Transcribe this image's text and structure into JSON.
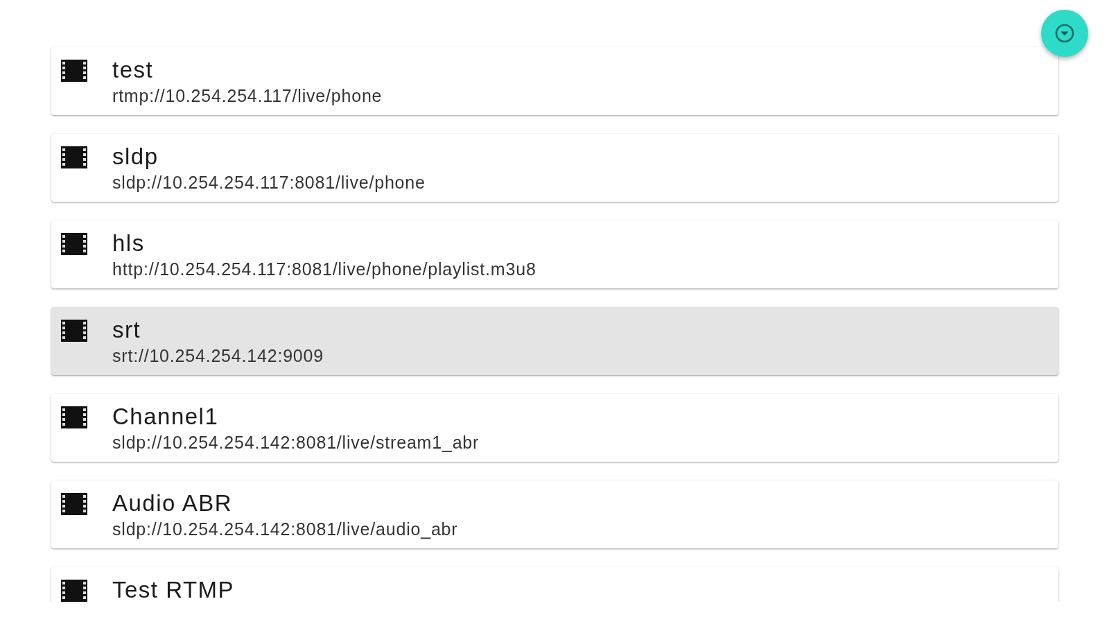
{
  "streams": [
    {
      "name": "test",
      "url": "rtmp://10.254.254.117/live/phone",
      "selected": false
    },
    {
      "name": "sldp",
      "url": "sldp://10.254.254.117:8081/live/phone",
      "selected": false
    },
    {
      "name": "hls",
      "url": "http://10.254.254.117:8081/live/phone/playlist.m3u8",
      "selected": false
    },
    {
      "name": "srt",
      "url": "srt://10.254.254.142:9009",
      "selected": true
    },
    {
      "name": "Channel1",
      "url": "sldp://10.254.254.142:8081/live/stream1_abr",
      "selected": false
    },
    {
      "name": "Audio ABR",
      "url": "sldp://10.254.254.142:8081/live/audio_abr",
      "selected": false
    },
    {
      "name": "Test RTMP",
      "selected": false
    }
  ]
}
